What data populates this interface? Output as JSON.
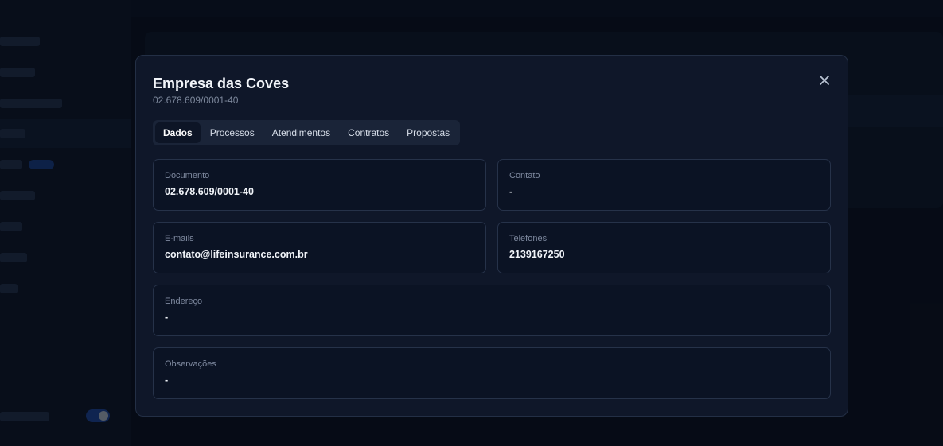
{
  "modal": {
    "title": "Empresa das Coves",
    "subtitle": "02.678.609/0001-40",
    "close_icon": "close-icon"
  },
  "tabs": [
    {
      "label": "Dados",
      "active": true
    },
    {
      "label": "Processos",
      "active": false
    },
    {
      "label": "Atendimentos",
      "active": false
    },
    {
      "label": "Contratos",
      "active": false
    },
    {
      "label": "Propostas",
      "active": false
    }
  ],
  "fields": {
    "documento": {
      "label": "Documento",
      "value": "02.678.609/0001-40"
    },
    "contato": {
      "label": "Contato",
      "value": "-"
    },
    "emails": {
      "label": "E-mails",
      "value": "contato@lifeinsurance.com.br"
    },
    "telefones": {
      "label": "Telefones",
      "value": "2139167250"
    },
    "endereco": {
      "label": "Endereço",
      "value": "-"
    },
    "observacoes": {
      "label": "Observações",
      "value": "-"
    }
  },
  "colors": {
    "background": "#0b1220",
    "modal": "#0f1729",
    "field_border": "#263249",
    "accent_toggle": "#2453b8"
  }
}
